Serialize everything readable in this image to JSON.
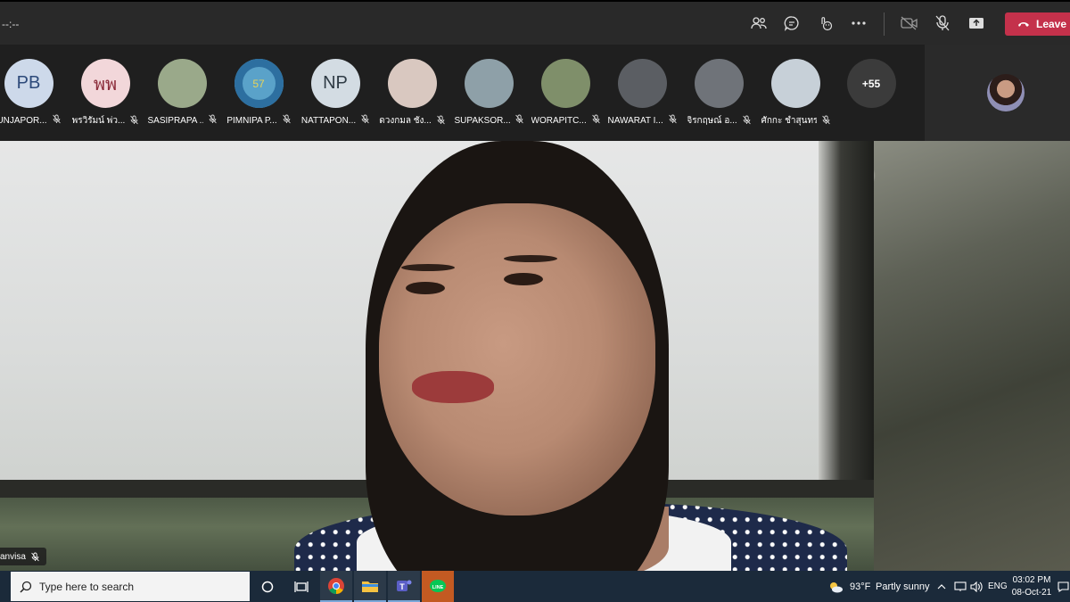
{
  "meeting": {
    "timer": "--:--",
    "leave_label": "Leave"
  },
  "toolbar_icons": [
    "people-icon",
    "chat-icon",
    "reactions-icon",
    "more-icon",
    "camera-off-icon",
    "mic-off-icon",
    "share-icon"
  ],
  "participants": [
    {
      "name": "UNJAPOR...",
      "initials": "PB",
      "avatar_bg": "#cdd9ea",
      "avatar_fg": "#2d4a7a"
    },
    {
      "name": "พรวิรัมน์ พ่ว...",
      "initials": "พพ",
      "avatar_bg": "#f2d7da",
      "avatar_fg": "#8b2c3a"
    },
    {
      "name": "SASIPRAPA ...",
      "initials": "",
      "avatar_bg": "#9aa98a",
      "avatar_fg": "#fff"
    },
    {
      "name": "PIMNIPA P...",
      "initials": "57",
      "avatar_bg": "#2d6fa0",
      "avatar_fg": "#e6d35a"
    },
    {
      "name": "NATTAPON...",
      "initials": "NP",
      "avatar_bg": "#d3dce3",
      "avatar_fg": "#2f3b45"
    },
    {
      "name": "ดวงกมล ชัง...",
      "initials": "",
      "avatar_bg": "#d9c8c0",
      "avatar_fg": "#fff"
    },
    {
      "name": "SUPAKSOR...",
      "initials": "",
      "avatar_bg": "#8ea0a8",
      "avatar_fg": "#fff"
    },
    {
      "name": "WORAPITC...",
      "initials": "",
      "avatar_bg": "#7f8f6a",
      "avatar_fg": "#fff"
    },
    {
      "name": "NAWARAT I...",
      "initials": "",
      "avatar_bg": "#5b5e63",
      "avatar_fg": "#fff"
    },
    {
      "name": "จิรกฤษณ์ อ...",
      "initials": "",
      "avatar_bg": "#6f7379",
      "avatar_fg": "#fff"
    },
    {
      "name": "ศักกะ ชำสุนทร",
      "initials": "",
      "avatar_bg": "#c7d0d8",
      "avatar_fg": "#fff"
    }
  ],
  "overflow_count": "+55",
  "speaker": {
    "name": "anvisa"
  },
  "taskbar": {
    "search_placeholder": "Type here to search",
    "weather_temp": "93°F",
    "weather_desc": "Partly sunny",
    "language": "ENG",
    "time": "03:02 PM",
    "date": "08-Oct-21"
  },
  "colors": {
    "leave": "#c4314b",
    "topbar": "#292929",
    "taskbar": "#1b2a3a"
  }
}
